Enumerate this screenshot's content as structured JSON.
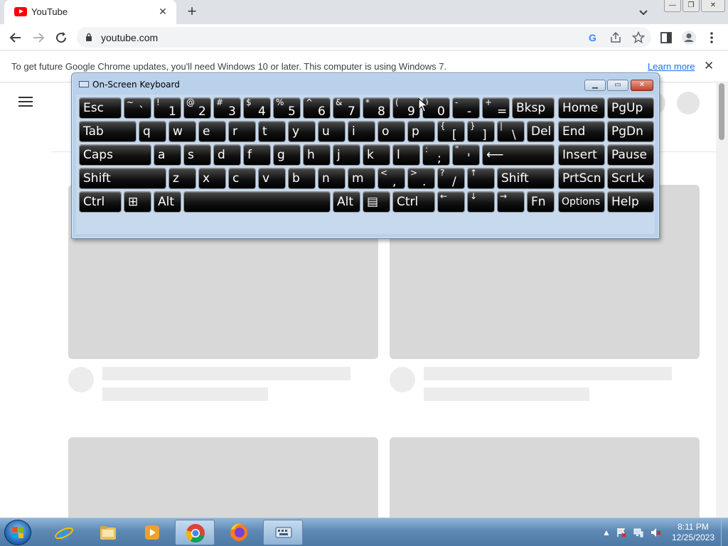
{
  "browser": {
    "tab": {
      "title": "YouTube",
      "close": "✕"
    },
    "new_tab": "+",
    "url": "youtube.com",
    "window_controls": {
      "minimize": "—",
      "restore": "❐",
      "close": "✕"
    }
  },
  "infobar": {
    "message": "To get future Google Chrome updates, you'll need Windows 10 or later. This computer is using Windows 7.",
    "learn_more": "Learn more",
    "close": "✕"
  },
  "osk": {
    "title": "On-Screen Keyboard",
    "rows": [
      [
        {
          "main": "Esc"
        },
        {
          "top": "~",
          "bottom": "`"
        },
        {
          "top": "!",
          "bottom": "1"
        },
        {
          "top": "@",
          "bottom": "2"
        },
        {
          "top": "#",
          "bottom": "3"
        },
        {
          "top": "$",
          "bottom": "4"
        },
        {
          "top": "%",
          "bottom": "5"
        },
        {
          "top": "^",
          "bottom": "6"
        },
        {
          "top": "&",
          "bottom": "7"
        },
        {
          "top": "*",
          "bottom": "8"
        },
        {
          "top": "(",
          "bottom": "9"
        },
        {
          "top": ")",
          "bottom": "0"
        },
        {
          "top": "-",
          "bottom": "-"
        },
        {
          "top": "+",
          "bottom": "="
        },
        {
          "main": "Bksp"
        },
        {
          "main": "Home"
        },
        {
          "main": "PgUp"
        }
      ],
      [
        {
          "main": "Tab"
        },
        {
          "main": "q"
        },
        {
          "main": "w"
        },
        {
          "main": "e"
        },
        {
          "main": "r"
        },
        {
          "main": "t"
        },
        {
          "main": "y"
        },
        {
          "main": "u"
        },
        {
          "main": "i"
        },
        {
          "main": "o"
        },
        {
          "main": "p"
        },
        {
          "top": "{",
          "bottom": "["
        },
        {
          "top": "}",
          "bottom": "]"
        },
        {
          "top": "|",
          "bottom": "\\"
        },
        {
          "main": "Del"
        },
        {
          "main": "End"
        },
        {
          "main": "PgDn"
        }
      ],
      [
        {
          "main": "Caps"
        },
        {
          "main": "a"
        },
        {
          "main": "s"
        },
        {
          "main": "d"
        },
        {
          "main": "f"
        },
        {
          "main": "g"
        },
        {
          "main": "h"
        },
        {
          "main": "j"
        },
        {
          "main": "k"
        },
        {
          "main": "l"
        },
        {
          "top": ":",
          "bottom": ";"
        },
        {
          "top": "\"",
          "bottom": "'"
        },
        {
          "main": "⟵"
        },
        {
          "main": "Insert"
        },
        {
          "main": "Pause"
        }
      ],
      [
        {
          "main": "Shift"
        },
        {
          "main": "z"
        },
        {
          "main": "x"
        },
        {
          "main": "c"
        },
        {
          "main": "v"
        },
        {
          "main": "b"
        },
        {
          "main": "n"
        },
        {
          "main": "m"
        },
        {
          "top": "<",
          "bottom": ","
        },
        {
          "top": ">",
          "bottom": "."
        },
        {
          "top": "?",
          "bottom": "/"
        },
        {
          "top": "↑",
          "bottom": ""
        },
        {
          "main": "Shift"
        },
        {
          "main": "PrtScn"
        },
        {
          "main": "ScrLk"
        }
      ],
      [
        {
          "main": "Ctrl"
        },
        {
          "main": "⊞"
        },
        {
          "main": "Alt"
        },
        {
          "main": ""
        },
        {
          "main": "Alt"
        },
        {
          "main": "▤"
        },
        {
          "main": "Ctrl"
        },
        {
          "top": "←",
          "bottom": ""
        },
        {
          "top": "↓",
          "bottom": ""
        },
        {
          "top": "→",
          "bottom": ""
        },
        {
          "main": "Fn"
        },
        {
          "main": "Options",
          "small": true
        },
        {
          "main": "Help"
        }
      ]
    ]
  },
  "taskbar": {
    "apps": [
      "start",
      "internet-explorer",
      "windows-explorer",
      "media-player",
      "chrome",
      "firefox",
      "on-screen-keyboard"
    ],
    "active_app": "on-screen-keyboard",
    "time": "8:11 PM",
    "date": "12/25/2023"
  },
  "colors": {
    "youtube_red": "#ff0000",
    "link_blue": "#1a73e8",
    "osk_frame": "#b9d1ea"
  }
}
